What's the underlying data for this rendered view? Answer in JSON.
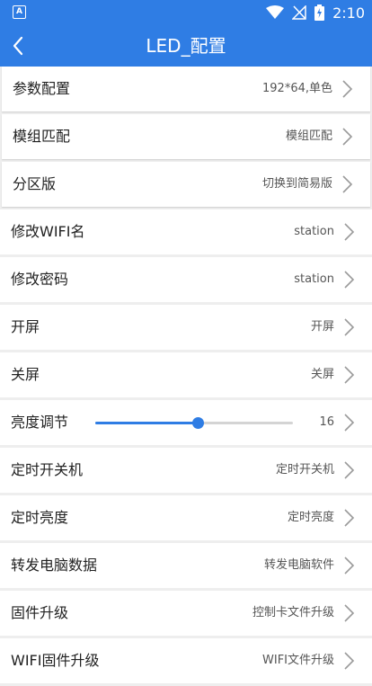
{
  "status_bar": {
    "app_badge": "A",
    "time": "2:10",
    "icons": [
      "wifi-icon",
      "no-signal-icon",
      "battery-charging-icon"
    ]
  },
  "app_bar": {
    "title": "LED_配置",
    "back_icon": "chevron-left-icon"
  },
  "colors": {
    "primary": "#2f7de4",
    "row_bg": "#ffffff",
    "page_bg": "#eeeeee",
    "chevron": "#9a9a9a"
  },
  "settings": [
    {
      "label": "参数配置",
      "value": "192*64,单色"
    },
    {
      "label": "模组匹配",
      "value": "模组匹配"
    },
    {
      "label": "分区版",
      "value": "切换到简易版"
    },
    {
      "label": "修改WIFI名",
      "value": "station"
    },
    {
      "label": "修改密码",
      "value": "station"
    },
    {
      "label": "开屏",
      "value": "开屏"
    },
    {
      "label": "关屏",
      "value": "关屏"
    },
    {
      "label": "亮度调节",
      "value": "16",
      "slider_fraction": 0.52
    },
    {
      "label": "定时开关机",
      "value": "定时开关机"
    },
    {
      "label": "定时亮度",
      "value": "定时亮度"
    },
    {
      "label": "转发电脑数据",
      "value": "转发电脑软件"
    },
    {
      "label": "固件升级",
      "value": "控制卡文件升级"
    },
    {
      "label": "WIFI固件升级",
      "value": "WIFI文件升级"
    }
  ]
}
